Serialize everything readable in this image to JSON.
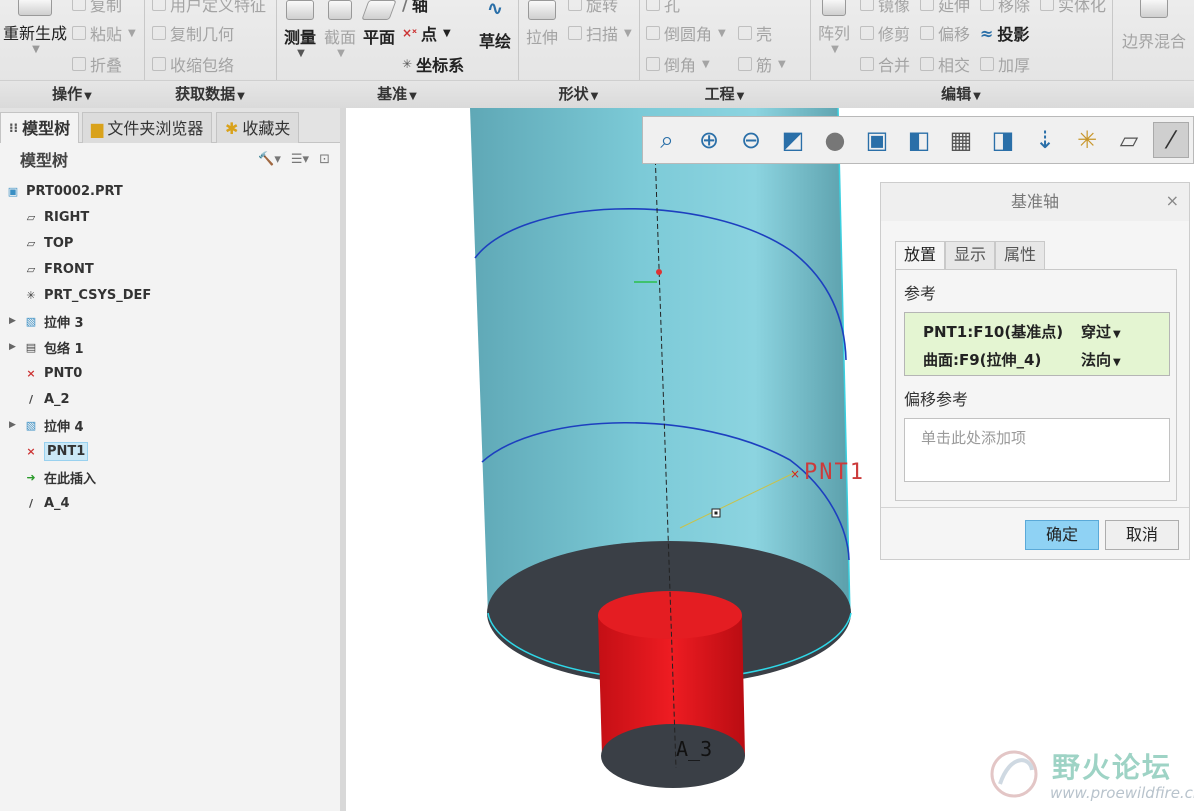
{
  "ribbon": {
    "groups": [
      "操作",
      "获取数据",
      "基准",
      "形状",
      "工程",
      "编辑"
    ],
    "buttons": {
      "regen": "重新生成",
      "copy": "复制",
      "paste": "粘贴",
      "fold": "折叠",
      "udf": "用户定义特征",
      "copy_geom": "复制几何",
      "shrinkwrap": "收缩包络",
      "measure": "测量",
      "section": "截面",
      "plane": "平面",
      "axis": "轴",
      "point": "点",
      "csys": "坐标系",
      "sketch": "草绘",
      "extrude": "拉伸",
      "revolve": "旋转",
      "sweep": "扫描",
      "hole": "孔",
      "round": "倒圆角",
      "chamfer": "倒角",
      "shell": "壳",
      "rib": "筋",
      "pattern": "阵列",
      "mirror": "镜像",
      "extend": "延伸",
      "move": "移除",
      "solidify": "实体化",
      "trim": "修剪",
      "offset": "偏移",
      "project": "投影",
      "merge": "合并",
      "intersect": "相交",
      "thicken": "加厚",
      "boundary": "边界混合"
    }
  },
  "leftpanel": {
    "tabs": [
      "模型树",
      "文件夹浏览器",
      "收藏夹"
    ],
    "tree_header": "模型树",
    "items": [
      {
        "label": "PRT0002.PRT",
        "icon": "part-icon",
        "expand": ""
      },
      {
        "label": "RIGHT",
        "icon": "datum-plane-icon",
        "expand": ""
      },
      {
        "label": "TOP",
        "icon": "datum-plane-icon",
        "expand": ""
      },
      {
        "label": "FRONT",
        "icon": "datum-plane-icon",
        "expand": ""
      },
      {
        "label": "PRT_CSYS_DEF",
        "icon": "csys-icon",
        "expand": ""
      },
      {
        "label": "拉伸 3",
        "icon": "extrude-icon",
        "expand": "▶"
      },
      {
        "label": "包络 1",
        "icon": "wrap-icon",
        "expand": "▶"
      },
      {
        "label": "PNT0",
        "icon": "datum-point-icon",
        "expand": ""
      },
      {
        "label": "A_2",
        "icon": "datum-axis-icon",
        "expand": ""
      },
      {
        "label": "拉伸 4",
        "icon": "extrude-icon",
        "expand": "▶"
      },
      {
        "label": "PNT1",
        "icon": "datum-point-icon",
        "expand": "",
        "selected": true
      },
      {
        "label": "在此插入",
        "icon": "insert-arrow-icon",
        "expand": ""
      },
      {
        "label": "A_4",
        "icon": "datum-axis-icon",
        "expand": ""
      }
    ]
  },
  "viewport": {
    "labels": {
      "pnt": "PNT1",
      "axis": "A_3"
    },
    "colors": {
      "cylinder": "#74c2cf",
      "end_face": "#3a3f46",
      "boss": "#e0141a",
      "curve": "#1d3fbf"
    }
  },
  "dialog": {
    "title": "基准轴",
    "close": "×",
    "tabs": [
      "放置",
      "显示",
      "属性"
    ],
    "ref_label": "参考",
    "refs": [
      {
        "name": "PNT1:F10(基准点)",
        "type": "穿过"
      },
      {
        "name": "曲面:F9(拉伸_4)",
        "type": "法向"
      }
    ],
    "offset_label": "偏移参考",
    "offset_placeholder": "单击此处添加项",
    "ok": "确定",
    "cancel": "取消"
  },
  "watermark": {
    "title": "野火论坛",
    "url": "www.proewildfire.cn"
  }
}
